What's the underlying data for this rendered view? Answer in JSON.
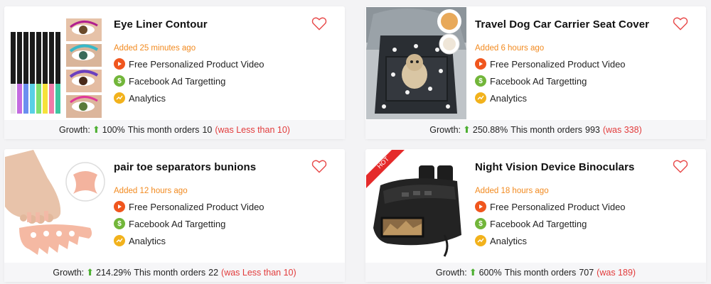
{
  "labels": {
    "growth_prefix": "Growth:",
    "orders_prefix": "This month orders",
    "features": [
      "Free Personalized Product Video",
      "Facebook Ad Targetting",
      "Analytics"
    ]
  },
  "icons": {
    "favorite": "heart-outline-icon",
    "video": "play-icon",
    "facebook": "dollar-icon",
    "analytics": "trend-icon",
    "growth": "up-arrow-icon"
  },
  "colors": {
    "added": "#f28a1f",
    "was": "#e23b3b",
    "heart": "#e84a4a",
    "arrow": "#4caf30",
    "hot_ribbon": "#e52a2a"
  },
  "products": [
    {
      "title": "Eye Liner Contour",
      "added": "Added 25 minutes ago",
      "growth": "100%",
      "orders": "10",
      "was": "(was Less than 10)"
    },
    {
      "title": "Travel Dog Car Carrier Seat Cover",
      "added": "Added 6 hours ago",
      "growth": "250.88%",
      "orders": "993",
      "was": "(was 338)"
    },
    {
      "title": "pair toe separators bunions",
      "added": "Added 12 hours ago",
      "growth": "214.29%",
      "orders": "22",
      "was": "(was Less than 10)"
    },
    {
      "title": "Night Vision Device Binoculars",
      "added": "Added 18 hours ago",
      "growth": "600%",
      "orders": "707",
      "was": "(was 189)",
      "badge": "HOT"
    }
  ]
}
